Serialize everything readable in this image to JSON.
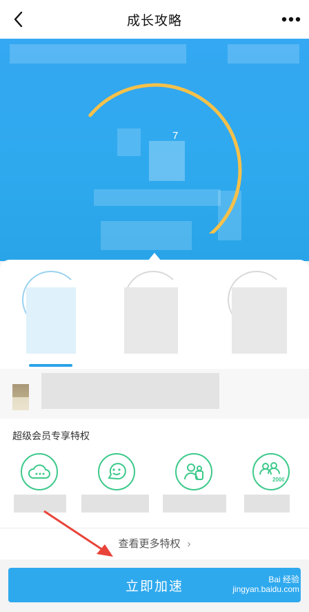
{
  "header": {
    "title": "成长攻略",
    "back_icon": "chevron-left-icon",
    "more_icon": "more-dots-icon"
  },
  "gauge": {
    "value_label": "7",
    "progress": 0.78,
    "arc_color": "#f5c14a",
    "track_color": "#5ac8fa"
  },
  "privileges": {
    "section_title": "超级会员专享特权",
    "items": [
      {
        "icon": "cloud-chat-icon"
      },
      {
        "icon": "smile-bubble-icon"
      },
      {
        "icon": "people-badge-icon"
      },
      {
        "icon": "crowd-2000-icon",
        "badge": "2000"
      }
    ],
    "more_label": "查看更多特权"
  },
  "action": {
    "button_label": "立即加速"
  },
  "colors": {
    "accent": "#2fa9ee",
    "privilege": "#3cc98a",
    "arrow": "#e8443a"
  },
  "watermark": {
    "brand": "Bai 经验",
    "url": "jingyan.baidu.com"
  }
}
